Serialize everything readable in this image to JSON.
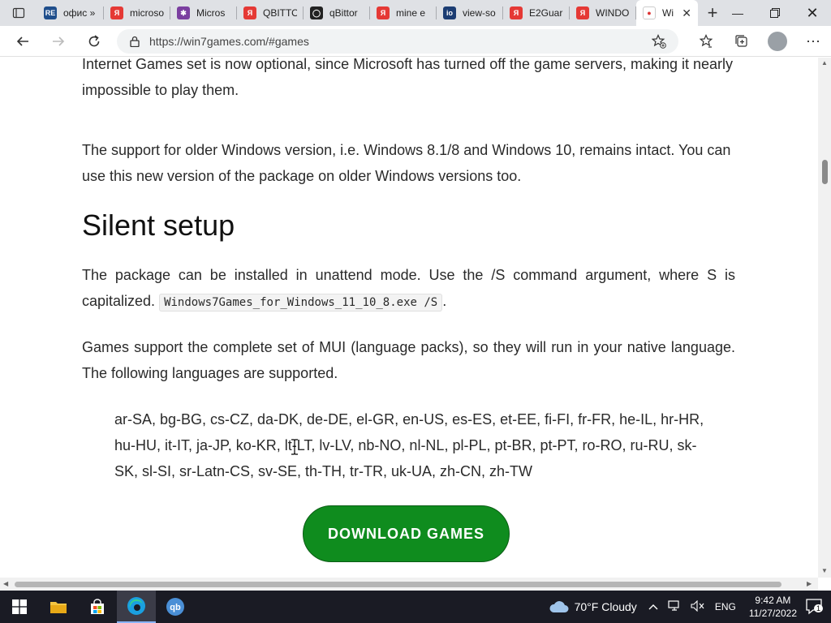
{
  "tabs": [
    {
      "title": "офис »",
      "favicon": "RE",
      "color": "#1f4e8c"
    },
    {
      "title": "microso",
      "favicon": "Я",
      "color": "#e53935"
    },
    {
      "title": "Micros",
      "favicon": "✱",
      "color": "#7b3fa0"
    },
    {
      "title": "QBITTO",
      "favicon": "Я",
      "color": "#e53935"
    },
    {
      "title": "qBittor",
      "favicon": "◯",
      "color": "#222222"
    },
    {
      "title": "mine e",
      "favicon": "Я",
      "color": "#e53935"
    },
    {
      "title": "view-so",
      "favicon": "io",
      "color": "#1c3d73"
    },
    {
      "title": "E2Guar",
      "favicon": "Я",
      "color": "#e53935"
    },
    {
      "title": "WINDO",
      "favicon": "Я",
      "color": "#e53935"
    }
  ],
  "active_tab": {
    "title": "Wi",
    "favicon": "●"
  },
  "address": {
    "url": "https://win7games.com/#games"
  },
  "content": {
    "p1": "Internet Games set is now optional, since Microsoft has turned off the game servers, making it nearly impossible to play them.",
    "p2": "The support for older Windows version, i.e. Windows 8.1/8 and Windows 10, remains intact. You can use this new version of the package on older Windows versions too.",
    "heading": "Silent setup",
    "p3_before": "The package can be installed in unattend mode. Use the /S command argument, where S is capitalized.",
    "p3_code": "Windows7Games_for_Windows_11_10_8.exe /S",
    "p3_after": ".",
    "p4": "Games support the complete set of MUI (language packs), so they will run in your native language. The following languages are supported.",
    "languages": "ar-SA, bg-BG, cs-CZ, da-DK, de-DE, el-GR, en-US, es-ES, et-EE, fi-FI, fr-FR, he-IL, hr-HR, hu-HU, it-IT, ja-JP, ko-KR, lt-LT, lv-LV, nb-NO, nl-NL, pl-PL, pt-BR, pt-PT, ro-RO, ru-RU, sk-SK, sl-SI, sr-Latn-CS, sv-SE, th-TH, tr-TR, uk-UA, zh-CN, zh-TW",
    "download_label": "DOWNLOAD GAMES"
  },
  "taskbar": {
    "weather": "70°F  Cloudy",
    "lang": "ENG",
    "time": "9:42 AM",
    "date": "11/27/2022",
    "notifications": "1"
  },
  "colors": {
    "download_green": "#0f8c1e",
    "taskbar": "#1a1b24"
  }
}
